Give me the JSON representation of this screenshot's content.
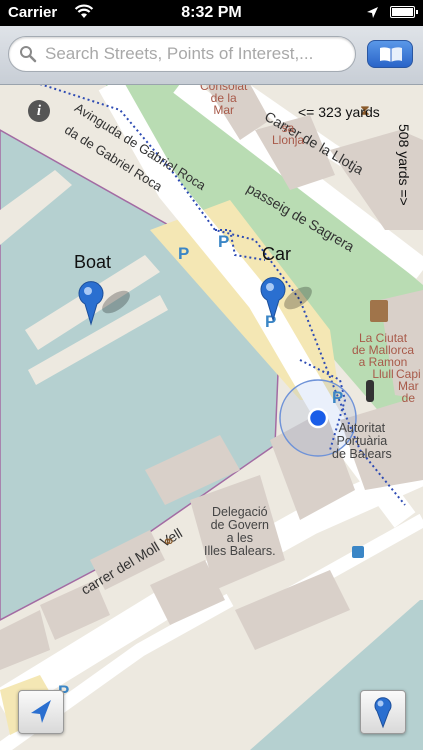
{
  "status_bar": {
    "carrier": "Carrier",
    "time": "8:32 PM"
  },
  "search": {
    "placeholder": "Search Streets, Points of Interest,..."
  },
  "map": {
    "streets": {
      "gabriel_roca_1": "Avinguda de Gabriel Roca",
      "gabriel_roca_2": "da de Gabriel Roca",
      "carrer_llotja": "Carrer de la Llotja",
      "passeig_sagrera": "passeig de Sagrera",
      "moll_vell": "carrer del Moll Vell"
    },
    "pois": {
      "consolat_line1": "Consolat",
      "consolat_line2": "de la",
      "consolat_line3": "Mar",
      "llonja_line1": "sa",
      "llonja_line2": "Llonja",
      "ciutat_line1": "La Ciutat",
      "ciutat_line2": "de Mallorca",
      "ciutat_line3": "a Ramon",
      "ciutat_line4": "Llull",
      "capi_line1": "Capi",
      "capi_line2": "Mar",
      "capi_line3": "de",
      "autoritat_line1": "Autoritat",
      "autoritat_line2": "Portuària",
      "autoritat_line3": "de Balears",
      "delegacio_line1": "Delegació",
      "delegacio_line2": "de Govern",
      "delegacio_line3": "a les",
      "delegacio_line4": "Illes Balears."
    },
    "parking_symbol": "P",
    "distance_horizontal": "<= 323 yards",
    "distance_vertical": "508 yards =>",
    "pins": [
      {
        "label": "Boat"
      },
      {
        "label": "Car"
      }
    ]
  },
  "colors": {
    "water": "#b5d0d0",
    "land": "#ede9e0",
    "park": "#b9dcb3",
    "road": "#ffffff",
    "building": "#d9d0c9",
    "pin": "#2a6fd0",
    "poi_text": "#a85a4a",
    "parking": "#3b86c6"
  },
  "icons": [
    "wifi-icon",
    "location-arrow-icon",
    "battery-icon",
    "search-icon",
    "bookmarks-icon",
    "info-icon",
    "locate-me-icon",
    "drop-pin-icon"
  ]
}
